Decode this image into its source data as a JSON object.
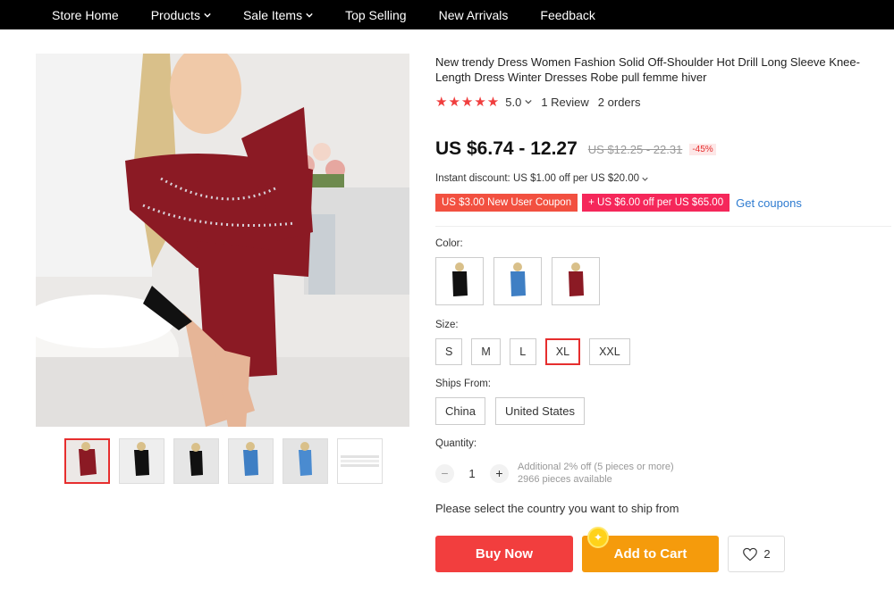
{
  "nav": {
    "items": [
      {
        "label": "Store Home",
        "dropdown": false
      },
      {
        "label": "Products",
        "dropdown": true
      },
      {
        "label": "Sale Items",
        "dropdown": true
      },
      {
        "label": "Top Selling",
        "dropdown": false
      },
      {
        "label": "New Arrivals",
        "dropdown": false
      },
      {
        "label": "Feedback",
        "dropdown": false
      }
    ]
  },
  "product": {
    "title": "New trendy Dress Women Fashion Solid Off-Shoulder Hot Drill Long Sleeve Knee-Length Dress Winter Dresses Robe pull femme hiver",
    "stars": "★★★★★",
    "rating": "5.0",
    "reviews": "1 Review",
    "orders": "2 orders",
    "price": "US $6.74 - 12.27",
    "original_price": "US $12.25 - 22.31",
    "discount": "-45%",
    "instant_discount": "Instant discount: US $1.00 off per US $20.00",
    "coupons": {
      "new_user": "US $3.00 New User Coupon",
      "off": "+ US $6.00 off per US $65.00",
      "get": "Get coupons"
    },
    "color_label": "Color:",
    "colors": [
      "black",
      "blue",
      "burgundy"
    ],
    "size_label": "Size:",
    "sizes": [
      "S",
      "M",
      "L",
      "XL",
      "XXL"
    ],
    "selected_size": "XL",
    "ships_label": "Ships From:",
    "ships_from": [
      "China",
      "United States"
    ],
    "quantity_label": "Quantity:",
    "quantity": "1",
    "quantity_info_1": "Additional 2% off (5 pieces or more)",
    "quantity_info_2": "2966 pieces available",
    "ship_note": "Please select the country you want to ship from",
    "buy_now": "Buy Now",
    "add_to_cart": "Add to Cart",
    "wishlist_count": "2"
  },
  "colors": {
    "accent_red": "#f23e3e",
    "cart_orange": "#f59b0c",
    "link_blue": "#2e7bd0",
    "dress_burgundy": "#8b1a24"
  }
}
